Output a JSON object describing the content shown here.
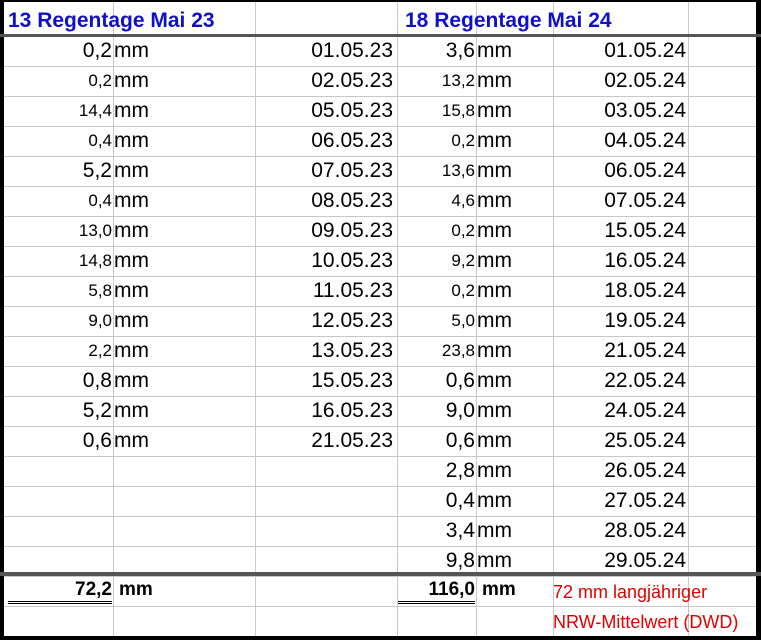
{
  "col_2023": {
    "title": "13 Regentage Mai 23",
    "unit": "mm",
    "rows": [
      {
        "value": "0,2",
        "date": "01.05.23"
      },
      {
        "value": "0,2",
        "date": "02.05.23"
      },
      {
        "value": "14,4",
        "date": "05.05.23"
      },
      {
        "value": "0,4",
        "date": "06.05.23"
      },
      {
        "value": "5,2",
        "date": "07.05.23"
      },
      {
        "value": "0,4",
        "date": "08.05.23"
      },
      {
        "value": "13,0",
        "date": "09.05.23"
      },
      {
        "value": "14,8",
        "date": "10.05.23"
      },
      {
        "value": "5,8",
        "date": "11.05.23"
      },
      {
        "value": "9,0",
        "date": "12.05.23"
      },
      {
        "value": "2,2",
        "date": "13.05.23"
      },
      {
        "value": "0,8",
        "date": "15.05.23"
      },
      {
        "value": "5,2",
        "date": "16.05.23"
      },
      {
        "value": "0,6",
        "date": "21.05.23"
      }
    ],
    "total": "72,2",
    "total_unit": "mm"
  },
  "col_2024": {
    "title": "18 Regentage Mai 24",
    "unit": "mm",
    "rows": [
      {
        "value": "3,6",
        "date": "01.05.24"
      },
      {
        "value": "13,2",
        "date": "02.05.24"
      },
      {
        "value": "15,8",
        "date": "03.05.24"
      },
      {
        "value": "0,2",
        "date": "04.05.24"
      },
      {
        "value": "13,6",
        "date": "06.05.24"
      },
      {
        "value": "4,6",
        "date": "07.05.24"
      },
      {
        "value": "0,2",
        "date": "15.05.24"
      },
      {
        "value": "9,2",
        "date": "16.05.24"
      },
      {
        "value": "0,2",
        "date": "18.05.24"
      },
      {
        "value": "5,0",
        "date": "19.05.24"
      },
      {
        "value": "23,8",
        "date": "21.05.24"
      },
      {
        "value": "0,6",
        "date": "22.05.24"
      },
      {
        "value": "9,0",
        "date": "24.05.24"
      },
      {
        "value": "0,6",
        "date": "25.05.24"
      },
      {
        "value": "2,8",
        "date": "26.05.24"
      },
      {
        "value": "0,4",
        "date": "27.05.24"
      },
      {
        "value": "3,4",
        "date": "28.05.24"
      },
      {
        "value": "9,8",
        "date": "29.05.24"
      }
    ],
    "total": "116,0",
    "total_unit": "mm"
  },
  "note": {
    "line1": "72 mm langjähriger",
    "line2": "NRW-Mittelwert (DWD)"
  },
  "colors": {
    "header_text": "#1010c8",
    "note_text": "#e00000",
    "grid": "#c8c8c8"
  }
}
